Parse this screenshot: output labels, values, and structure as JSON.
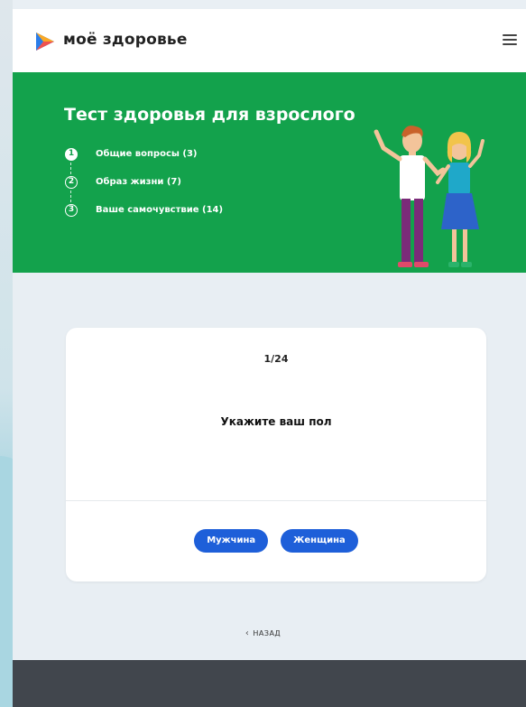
{
  "header": {
    "brand": "моё здоровье",
    "logo_colors": [
      "#2b7de9",
      "#f9a825",
      "#ef5350"
    ]
  },
  "hero": {
    "title": "Тест здоровья для взрослого",
    "steps": [
      {
        "num": "1",
        "label": "Общие вопросы (3)",
        "active": true
      },
      {
        "num": "2",
        "label": "Образ жизни (7)",
        "active": false
      },
      {
        "num": "3",
        "label": "Ваше самочувствие (14)",
        "active": false
      }
    ],
    "bg_color": "#13a24c"
  },
  "card": {
    "counter": "1/24",
    "question": "Укажите ваш пол",
    "answers": [
      "Мужчина",
      "Женщина"
    ],
    "button_color": "#1e5fd9"
  },
  "nav": {
    "back_label": "НАЗАД"
  }
}
